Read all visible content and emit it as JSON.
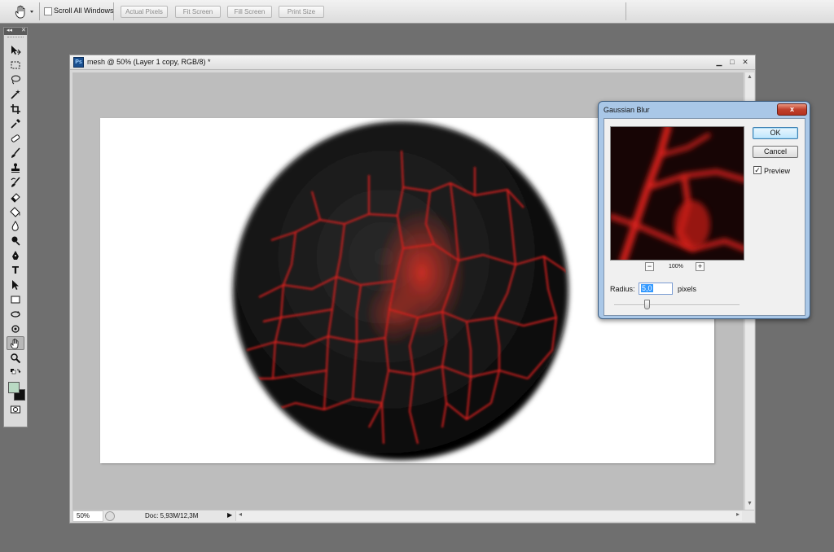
{
  "options_bar": {
    "scroll_all_windows": "Scroll All Windows",
    "buttons": [
      "Actual Pixels",
      "Fit Screen",
      "Fill Screen",
      "Print Size"
    ]
  },
  "document": {
    "title": "mesh @ 50% (Layer 1 copy, RGB/8) *",
    "zoom": "50%",
    "doc_info": "Doc: 5,93M/12,3M"
  },
  "dialog": {
    "title": "Gaussian Blur",
    "close": "x",
    "ok": "OK",
    "cancel": "Cancel",
    "preview_label": "Preview",
    "preview_checked": true,
    "zoom": "100%",
    "radius_label": "Radius:",
    "radius_value": "5,0",
    "units": "pixels"
  },
  "colors": {
    "lava_red": "#d6201c",
    "crust_black": "#0b0b0b",
    "foreground": "#111111",
    "background_swatch": "#b9d9c3"
  }
}
